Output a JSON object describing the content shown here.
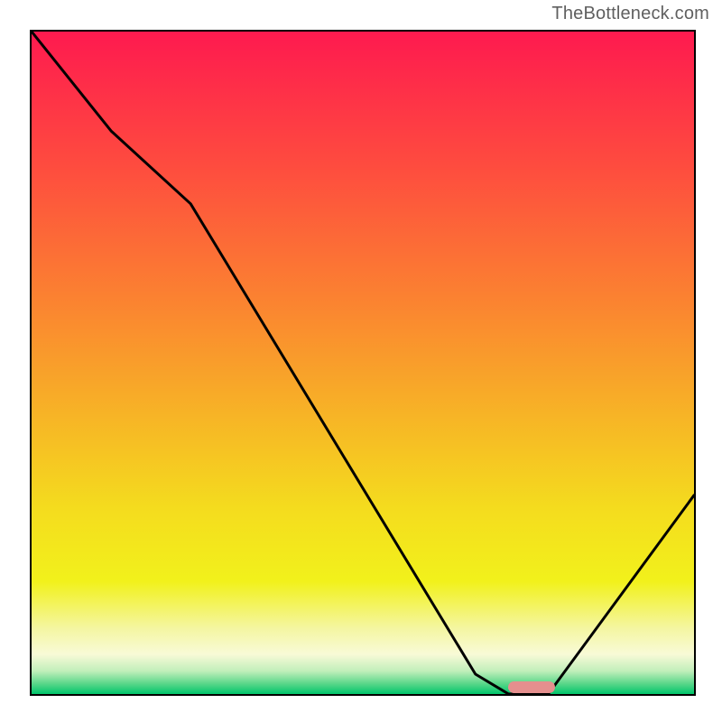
{
  "watermark": "TheBottleneck.com",
  "chart_data": {
    "type": "line",
    "title": "",
    "xlabel": "",
    "ylabel": "",
    "xlim": [
      0,
      100
    ],
    "ylim": [
      0,
      100
    ],
    "x": [
      0,
      12,
      24,
      67,
      72,
      78,
      100
    ],
    "values": [
      100,
      85,
      74,
      3,
      0,
      0,
      30
    ],
    "optimum_marker": {
      "x_start": 72,
      "x_end": 79,
      "y": 0,
      "color": "#e58f8e"
    },
    "background_gradient": {
      "direction": "vertical",
      "stops": [
        {
          "pos": 0.0,
          "color": "#fe1a4f"
        },
        {
          "pos": 0.2,
          "color": "#fe4b3f"
        },
        {
          "pos": 0.4,
          "color": "#fb8131"
        },
        {
          "pos": 0.58,
          "color": "#f7b426"
        },
        {
          "pos": 0.72,
          "color": "#f4dc1e"
        },
        {
          "pos": 0.83,
          "color": "#f2f11b"
        },
        {
          "pos": 0.9,
          "color": "#f4f6a0"
        },
        {
          "pos": 0.94,
          "color": "#f8fad7"
        },
        {
          "pos": 0.965,
          "color": "#c2efbb"
        },
        {
          "pos": 0.985,
          "color": "#56d688"
        },
        {
          "pos": 1.0,
          "color": "#00c56b"
        }
      ]
    }
  }
}
